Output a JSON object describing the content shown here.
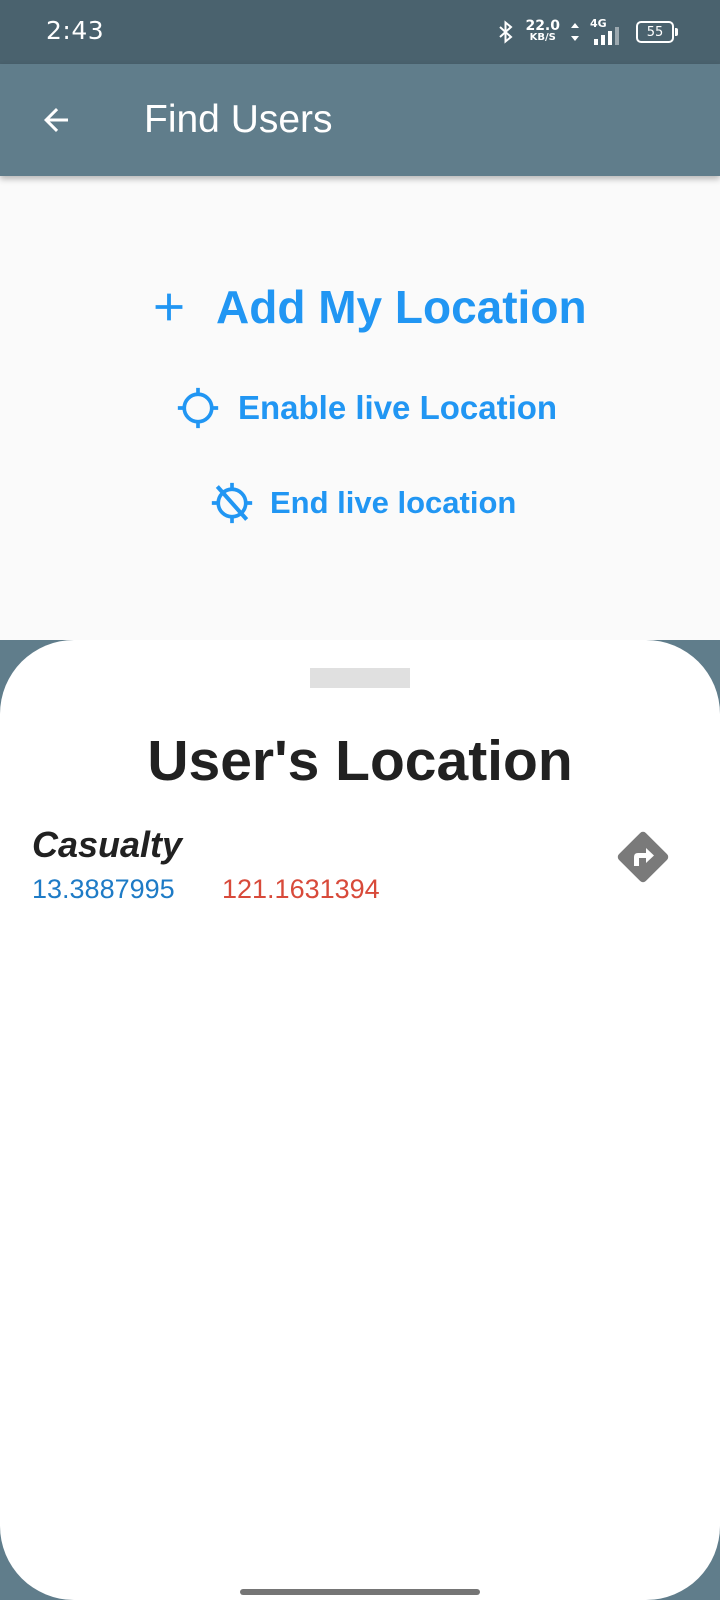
{
  "status_bar": {
    "time": "2:43",
    "net_speed_value": "22.0",
    "net_speed_unit": "KB/S",
    "network_type": "4G",
    "battery": "55",
    "icons": [
      "bluetooth-icon",
      "data-arrows-icon",
      "signal-icon",
      "battery-icon"
    ]
  },
  "app_bar": {
    "title": "Find Users",
    "back_icon": "arrow-back-icon",
    "color": "#607d8b"
  },
  "actions": {
    "add_location": {
      "label": "Add My Location",
      "icon": "plus-icon"
    },
    "enable_live": {
      "label": "Enable live Location",
      "icon": "gps-fixed-icon"
    },
    "end_live": {
      "label": "End live location",
      "icon": "gps-off-icon"
    },
    "accent_color": "#2196f3"
  },
  "sheet": {
    "title": "User's Location",
    "users": [
      {
        "name": "Casualty",
        "latitude": "13.3887995",
        "longitude": "121.1631394",
        "action_icon": "directions-icon"
      }
    ],
    "latitude_color": "#1e7bc6",
    "longitude_color": "#d84a3a"
  }
}
